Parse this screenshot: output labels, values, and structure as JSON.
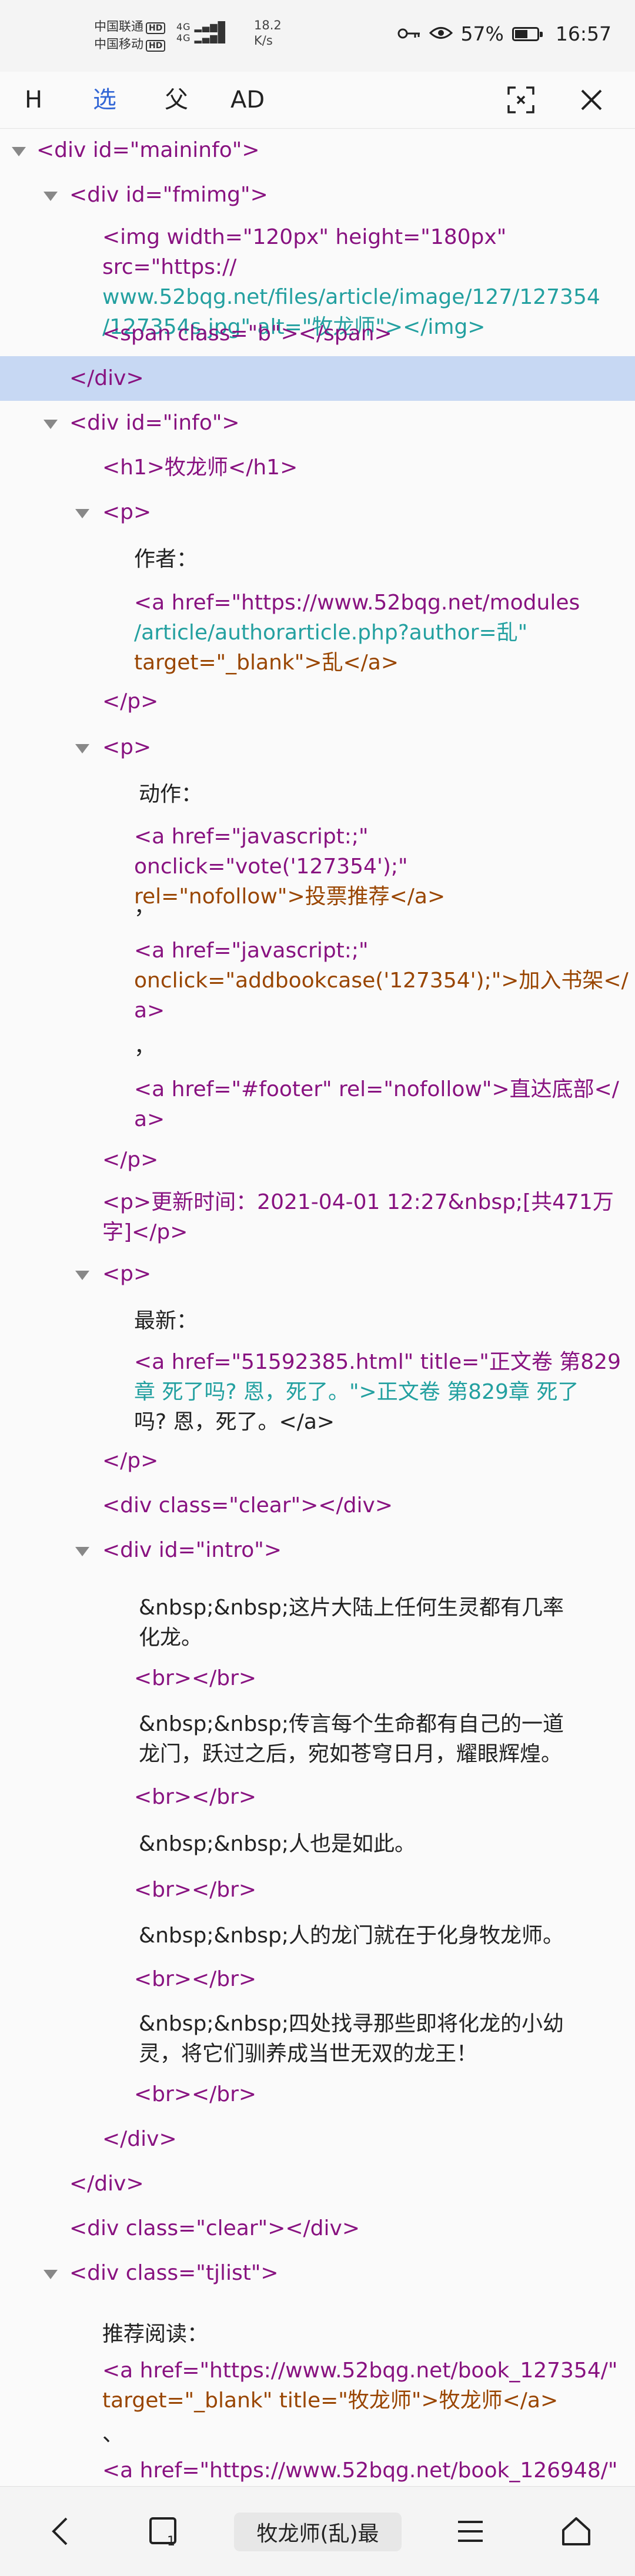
{
  "status_bar": {
    "carrier1": "中国联通",
    "carrier2": "中国移动",
    "hd": "HD",
    "signal1": "4G",
    "signal2": "4G",
    "speed_value": "18.2",
    "speed_unit": "K/s",
    "battery": "57%",
    "battery_level": 0.57,
    "time": "16:57"
  },
  "toolbar": {
    "h_label": "H",
    "select_label": "选",
    "parent_label": "父",
    "ad_label": "AD"
  },
  "tree": {
    "n1": "<div id=\"maininfo\">",
    "n2": "<div id=\"fmimg\">",
    "n3a": "<img width=\"120px\" height=\"180px\" src=\"https://",
    "n3b": "www.52bqg.net/files/article/image/127/127354",
    "n3c": "/127354s.jpg\" alt=\"牧龙师\"></img>",
    "n4": "<span class=\"b\"></span>",
    "n5": "</div>",
    "n6": "<div id=\"info\">",
    "n7": "<h1>牧龙师</h1>",
    "n8": "<p>",
    "n9": "作者：",
    "n10a": "<a href=\"https://www.52bqg.net/modules",
    "n10b": "/article/authorarticle.php?author=乱\"",
    "n10c": "target=\"_blank\">乱</a>",
    "n11": "</p>",
    "n12": "<p>",
    "n13": "动作：",
    "n14a": "<a href=\"javascript:;\" onclick=\"vote('127354');\"",
    "n14b": "rel=\"nofollow\">投票推荐</a>",
    "n15": "，",
    "n16a": "<a href=\"javascript:;\"",
    "n16b": "onclick=\"addbookcase('127354');\">加入书架</",
    "n16c": "a>",
    "n17": "，",
    "n18a": "<a href=\"#footer\" rel=\"nofollow\">直达底部</",
    "n18b": "a>",
    "n19": "</p>",
    "n20a": "<p>更新时间：2021-04-01 12:27&nbsp;[共471万",
    "n20b": "字]</p>",
    "n21": "<p>",
    "n22": "最新：",
    "n23a": "<a href=\"51592385.html\" title=\"正文卷 第829",
    "n23b": "章 死了吗? 恩，死了。\">正文卷 第829章 死了",
    "n23c": "吗? 恩，死了。</a>",
    "n24": "</p>",
    "n25": "<div class=\"clear\"></div>",
    "n26": "<div id=\"intro\">",
    "n27a": "&nbsp;&nbsp;这片大陆上任何生灵都有几率",
    "n27b": "化龙。",
    "n28": "<br></br>",
    "n29a": "&nbsp;&nbsp;传言每个生命都有自己的一道",
    "n29b": "龙门，跃过之后，宛如苍穹日月，耀眼辉煌。",
    "n30": "<br></br>",
    "n31": "&nbsp;&nbsp;人也是如此。",
    "n32": "<br></br>",
    "n33": "&nbsp;&nbsp;人的龙门就在于化身牧龙师。",
    "n34": "<br></br>",
    "n35a": "&nbsp;&nbsp;四处找寻那些即将化龙的小幼",
    "n35b": "灵，将它们驯养成当世无双的龙王！",
    "n36": "<br></br>",
    "n37": "</div>",
    "n38": "</div>",
    "n39": "<div class=\"clear\"></div>",
    "n40": "<div class=\"tjlist\">",
    "n41": "推荐阅读：",
    "n42a": "<a href=\"https://www.52bqg.net/book_127354/\"",
    "n42b": "target=\"_blank\" title=\"牧龙师\">牧龙师</a>",
    "n43": "、",
    "n44": "<a href=\"https://www.52bqg.net/book_126948/\""
  },
  "bottom_nav": {
    "title": "牧龙师(乱)最",
    "tabs_count": "1"
  },
  "colors": {
    "tag": "#881280",
    "attr_name": "#994500",
    "attr_value": "#23a0a0",
    "selected_row": "#c7d8f3",
    "active_tool": "#3367d6"
  }
}
